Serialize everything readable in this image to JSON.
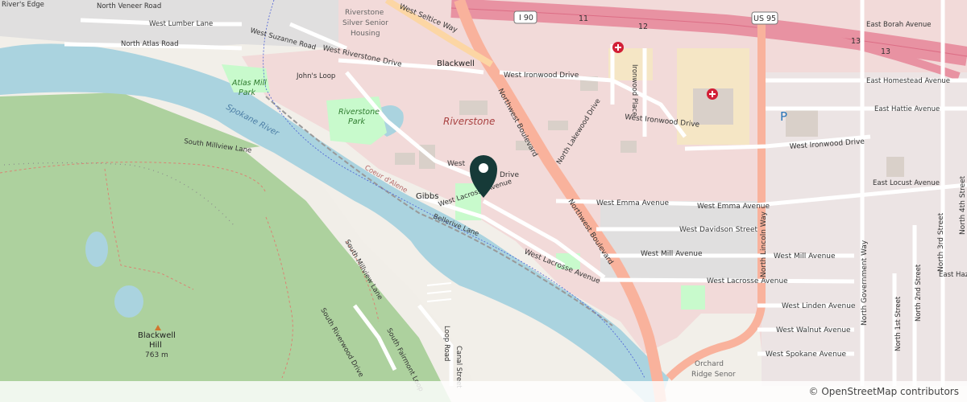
{
  "attribution": "© OpenStreetMap contributors",
  "colors": {
    "water": "#aad3df",
    "forest": "#add19e",
    "park": "#c8facc",
    "residential": "#e0dfdf",
    "commercial": "#f2dad9",
    "motorway": "#e892a2",
    "trunk": "#f9b29c",
    "primary": "#fcd6a4",
    "marker": "#163a38"
  },
  "labels": {
    "rivers_edge": "River's Edge",
    "north_veneer_road": "North Veneer Road",
    "west_lumber_lane": "West Lumber Lane",
    "north_atlas_road": "North Atlas Road",
    "west_suzanne_road": "West Suzanne Road",
    "riverstone_housing_1": "Riverstone",
    "riverstone_housing_2": "Silver Senior",
    "riverstone_housing_3": "Housing",
    "west_riverstone_drive": "West Riverstone Drive",
    "west_seltice_way": "West Seltice Way",
    "blackwell": "Blackwell",
    "i90": "I 90",
    "exit_11": "11",
    "exit_12": "12",
    "exit_13": "13",
    "us95": "US 95",
    "east_borah_avenue": "East Borah Avenue",
    "johns_loop": "John's Loop",
    "atlas_mill_park_1": "Atlas Mill",
    "atlas_mill_park_2": "Park",
    "riverstone_park_1": "Riverstone",
    "riverstone_park_2": "Park",
    "riverstone": "Riverstone",
    "west_ironwood_drive_1": "West Ironwood Drive",
    "west_ironwood_drive_2": "West Ironwood Drive",
    "west_ironwood_drive_3": "West Ironwood Drive",
    "ironwood_place": "Ironwood Place",
    "northwest_boulevard_1": "Northwest Boulevard",
    "northwest_boulevard_2": "Northwest Boulevard",
    "north_lakewood_drive": "North Lakewood Drive",
    "east_homestead_avenue": "East Homestead Avenue",
    "east_hattie_avenue": "East Hattie Avenue",
    "parking": "P",
    "spokane_river": "Spokane River",
    "south_millview_lane": "South Millview Lane",
    "south_millview_lane_2": "South Millview Lane",
    "coeur_dalene": "Coeur d'Alene",
    "west_drive_part1": "West",
    "west_drive_part2": "Drive",
    "gibbs": "Gibbs",
    "west_lacrosse_avenue_1": "West Lacrosse Avenue",
    "west_lacrosse_avenue_2": "West Lacrosse Avenue",
    "west_lacrosse_avenue_3": "West Lacrosse Avenue",
    "bellerive_lane": "Bellerive Lane",
    "west_emma_avenue_1": "West Emma Avenue",
    "west_emma_avenue_2": "West Emma Avenue",
    "east_locust_avenue": "East Locust Avenue",
    "west_davidson_street": "West Davidson Street",
    "north_lincoln_way": "North Lincoln Way",
    "west_mill_avenue_1": "West Mill Avenue",
    "west_mill_avenue_2": "West Mill Avenue",
    "north_government_way": "North Government Way",
    "north_3rd_street": "North 3rd Street",
    "north_4th_street": "North 4th Street",
    "east_haz": "East Haz",
    "north_2nd_street": "North 2nd Street",
    "north_1st_street": "North 1st Street",
    "west_linden_avenue": "West Linden Avenue",
    "west_walnut_avenue": "West Walnut Avenue",
    "west_spokane_avenue": "West Spokane Avenue",
    "orchard_ridge_1": "Orchard",
    "orchard_ridge_2": "Ridge Senor",
    "blackwell_hill_1": "Blackwell",
    "blackwell_hill_2": "Hill",
    "blackwell_hill_3": "763 m",
    "south_riverwood_drive": "South Riverwood Drive",
    "south_fairmont_loop": "South Fairmont Loop",
    "loop_road": "Loop Road",
    "canal_street": "Canal Street"
  }
}
